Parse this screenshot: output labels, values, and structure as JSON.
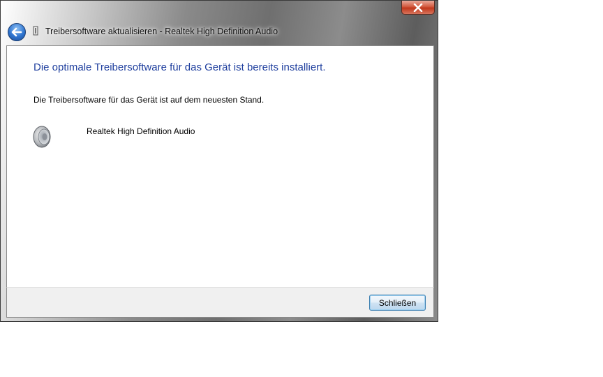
{
  "window": {
    "title": "Treibersoftware aktualisieren - Realtek High Definition Audio"
  },
  "icons": {
    "back": "back-arrow-icon",
    "close": "close-x-icon",
    "device": "speaker-icon"
  },
  "main": {
    "heading": "Die optimale Treibersoftware für das Gerät ist bereits installiert.",
    "status": "Die Treibersoftware für das Gerät ist auf dem neuesten Stand.",
    "device_name": "Realtek High Definition Audio"
  },
  "footer": {
    "close_label": "Schließen"
  },
  "colors": {
    "heading": "#1f3f9e",
    "close_button": "#c1371c"
  }
}
